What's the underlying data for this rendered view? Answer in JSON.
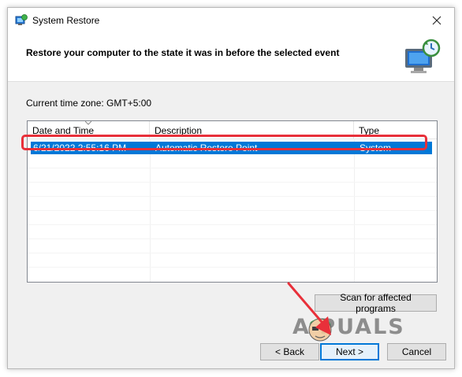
{
  "window": {
    "title": "System Restore"
  },
  "header": {
    "title": "Restore your computer to the state it was in before the selected event"
  },
  "timezone_label": "Current time zone: GMT+5:00",
  "table": {
    "columns": [
      "Date and Time",
      "Description",
      "Type"
    ],
    "rows": [
      {
        "date": "6/21/2022 2:55:16 PM",
        "description": "Automatic Restore Point",
        "type": "System",
        "selected": true
      }
    ]
  },
  "buttons": {
    "scan": "Scan for affected programs",
    "back": "< Back",
    "next": "Next >",
    "cancel": "Cancel"
  },
  "watermark": "A PUALS",
  "colors": {
    "selection": "#0078d7",
    "highlight_annotation": "#e8303a"
  },
  "icons": [
    "system-restore-app-icon",
    "close-icon",
    "system-restore-header-icon",
    "sort-arrow-icon",
    "annotation-arrow-icon"
  ]
}
